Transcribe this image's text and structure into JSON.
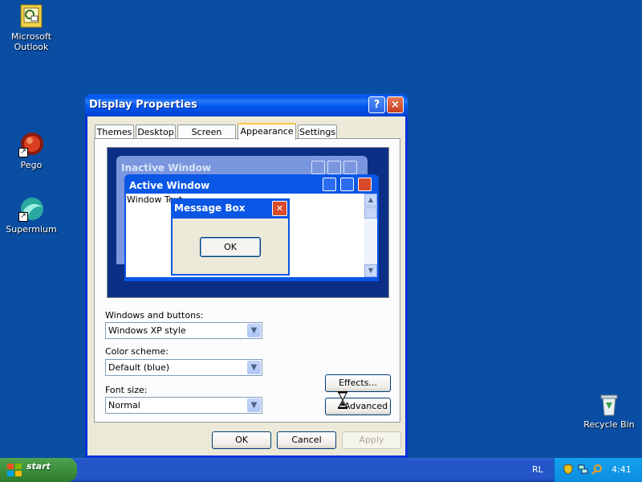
{
  "desktop": {
    "icons": [
      {
        "label": "Microsoft\nOutlook"
      },
      {
        "label": "Pego"
      },
      {
        "label": "Supermium"
      },
      {
        "label": "Recycle Bin"
      }
    ]
  },
  "taskbar": {
    "start_label": "start",
    "language": "RL",
    "clock": "4:41"
  },
  "dialog": {
    "title": "Display Properties",
    "help_glyph": "?",
    "close_glyph": "×",
    "tabs": [
      {
        "label": "Themes",
        "active": false
      },
      {
        "label": "Desktop",
        "active": false
      },
      {
        "label": "Screen Saver",
        "active": false
      },
      {
        "label": "Appearance",
        "active": true
      },
      {
        "label": "Settings",
        "active": false
      }
    ],
    "preview": {
      "inactive_title": "Inactive Window",
      "active_title": "Active Window",
      "window_text": "Window Text",
      "message_title": "Message Box",
      "message_ok": "OK"
    },
    "windows_buttons_label": "Windows and buttons:",
    "windows_buttons_value": "Windows XP style",
    "color_scheme_label": "Color scheme:",
    "color_scheme_value": "Default (blue)",
    "font_size_label": "Font size:",
    "font_size_value": "Normal",
    "effects_label": "Effects...",
    "advanced_label": "Advanced",
    "ok_label": "OK",
    "cancel_label": "Cancel",
    "apply_label": "Apply"
  },
  "colors": {
    "desktop": "#0a4ea3",
    "titlebar": "#0058ee",
    "window_face": "#ece9d8",
    "start_green": "#3c8f3c",
    "tray_blue": "#0c8ce0"
  }
}
